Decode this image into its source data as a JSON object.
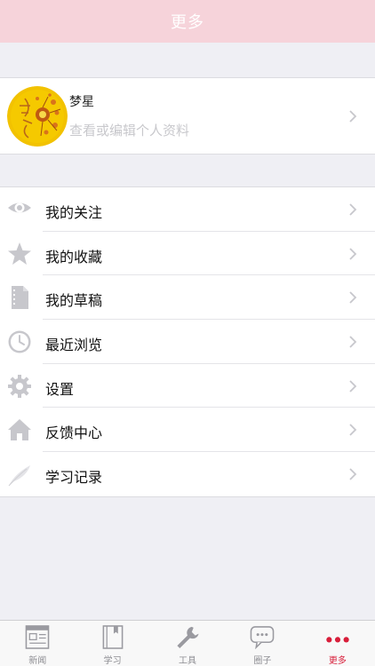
{
  "header": {
    "title": "更多"
  },
  "profile": {
    "name": "梦星",
    "subtitle": "查看或编辑个人资料"
  },
  "menu": {
    "items": [
      {
        "label": "我的关注",
        "icon": "eye-icon"
      },
      {
        "label": "我的收藏",
        "icon": "star-icon"
      },
      {
        "label": "我的草稿",
        "icon": "draft-icon"
      },
      {
        "label": "最近浏览",
        "icon": "clock-icon"
      },
      {
        "label": "设置",
        "icon": "gear-icon"
      },
      {
        "label": "反馈中心",
        "icon": "home-icon"
      },
      {
        "label": "学习记录",
        "icon": "feather-icon"
      }
    ]
  },
  "tabbar": {
    "tabs": [
      {
        "label": "新闻",
        "icon": "news-icon"
      },
      {
        "label": "学习",
        "icon": "book-icon"
      },
      {
        "label": "工具",
        "icon": "wrench-icon"
      },
      {
        "label": "圈子",
        "icon": "chat-bubble-icon"
      },
      {
        "label": "更多",
        "icon": "more-dots-icon",
        "active": true
      }
    ]
  },
  "colors": {
    "header_bg": "#f6d3da",
    "active_tab": "#d81e3a",
    "icon_gray": "#c7c7cc",
    "page_bg": "#efeff4"
  }
}
